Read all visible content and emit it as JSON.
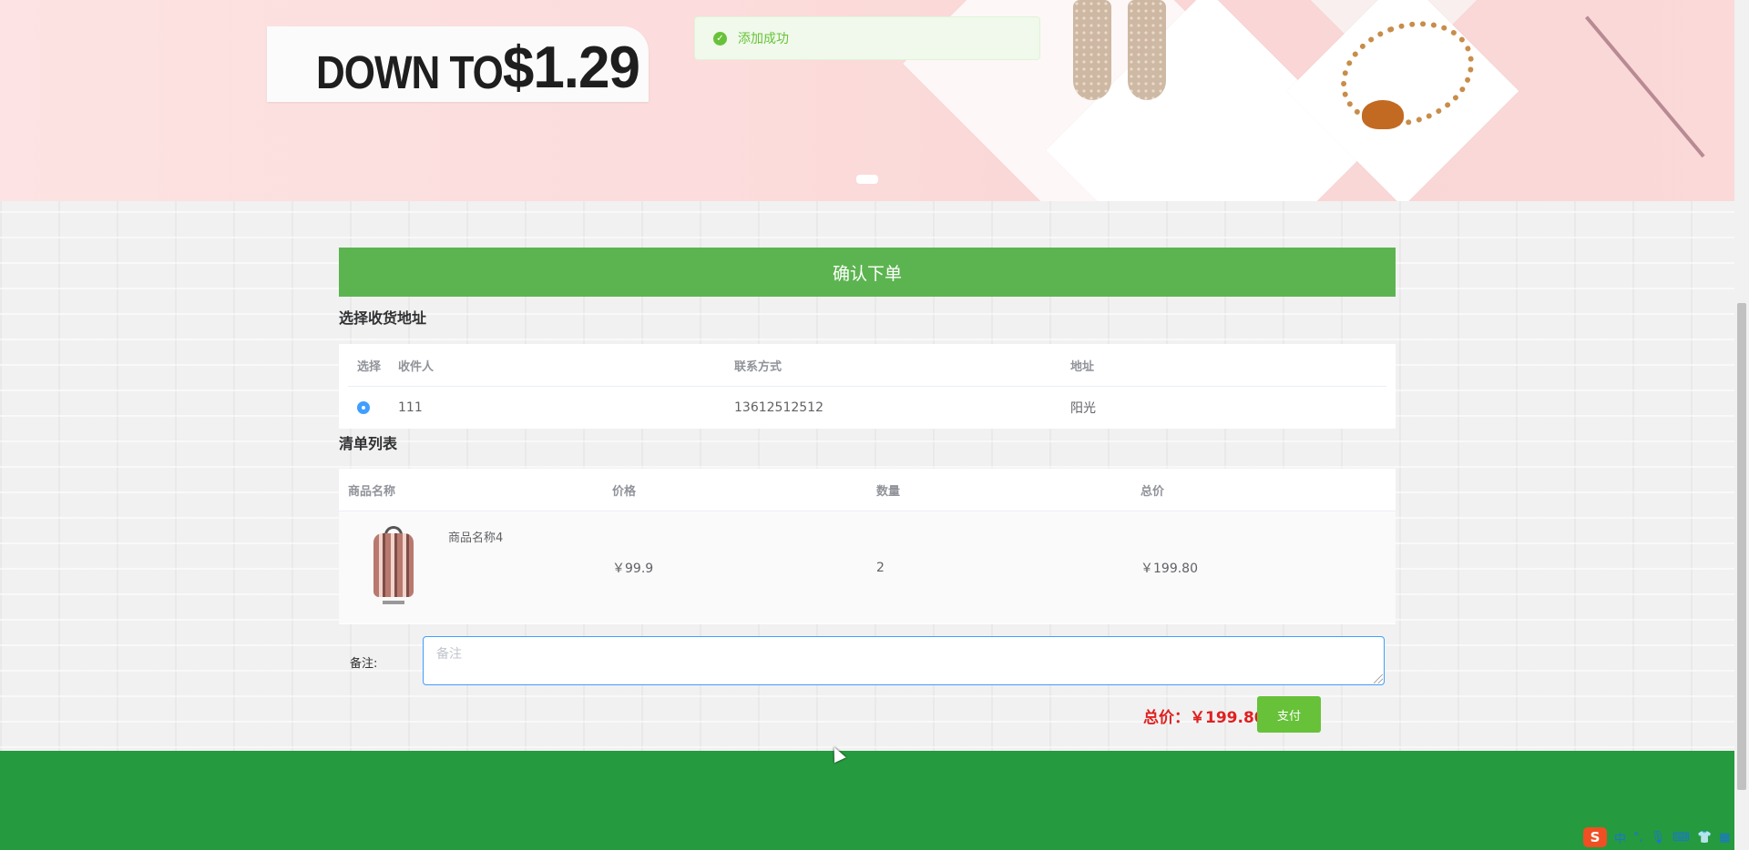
{
  "banner": {
    "promo_text_down": "DOWN TO ",
    "promo_text_price": "$1.29"
  },
  "toast": {
    "message": "添加成功",
    "color": "#67c23a"
  },
  "page": {
    "confirm_title": "确认下单",
    "address_section_title": "选择收货地址",
    "list_section_title": "清单列表"
  },
  "address_table": {
    "columns": [
      "选择",
      "收件人",
      "联系方式",
      "地址"
    ],
    "rows": [
      {
        "selected": true,
        "recipient": "111",
        "phone": "13612512512",
        "address": "阳光"
      }
    ]
  },
  "items_table": {
    "columns": [
      "商品名称",
      "价格",
      "数量",
      "总价"
    ],
    "rows": [
      {
        "name": "商品名称4",
        "price": "￥99.9",
        "quantity": "2",
        "total": "￥199.80"
      }
    ]
  },
  "remark": {
    "label": "备注:",
    "placeholder": "备注",
    "value": ""
  },
  "summary": {
    "total_label": "总价：￥199.80",
    "pay_button": "支付"
  },
  "ime": {
    "logo": "S",
    "lang": "中",
    "punct": "°,",
    "items": [
      "mic-icon",
      "keyboard-icon",
      "shirt-icon",
      "grid-icon"
    ]
  },
  "colors": {
    "accent_green": "#5cb450",
    "footer_green": "#269a3e",
    "price_red": "#e02020",
    "pay_green": "#67c23a",
    "radio_blue": "#409eff"
  }
}
